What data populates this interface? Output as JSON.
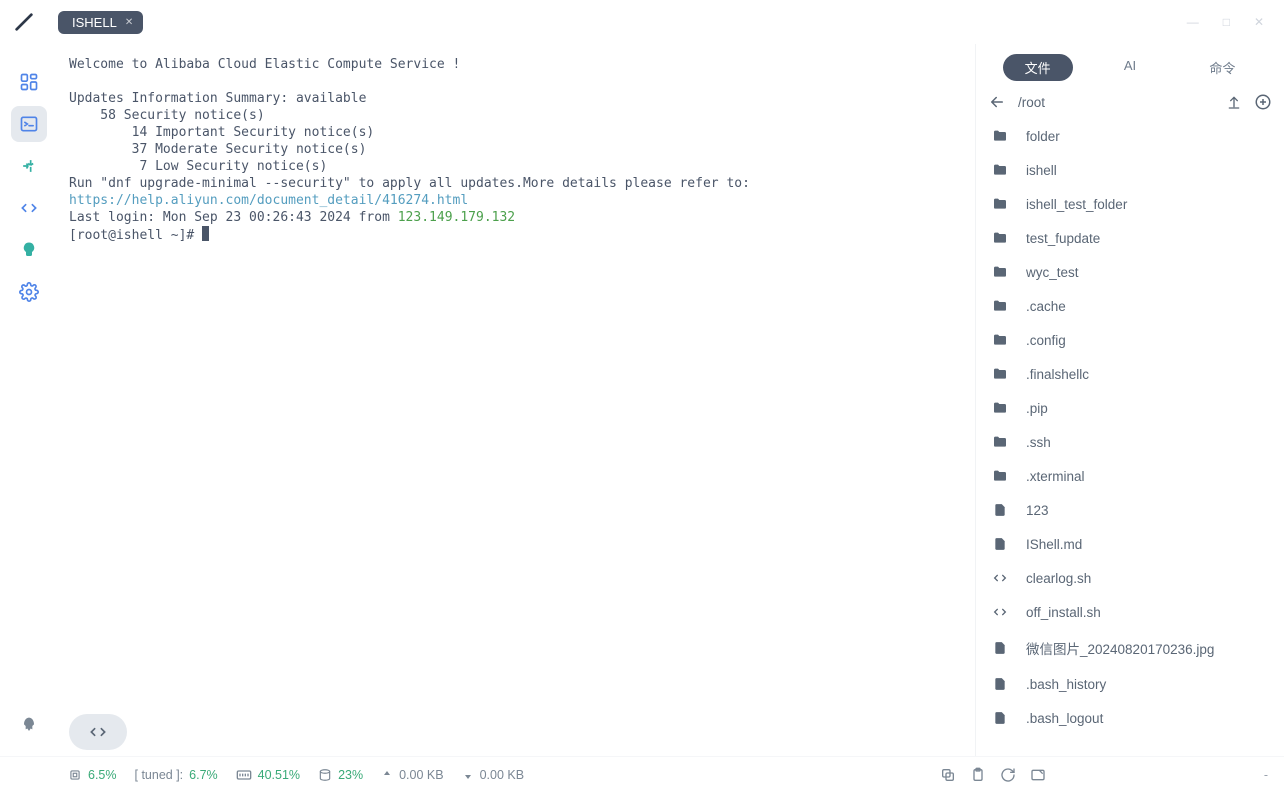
{
  "app": {
    "tab_label": "ISHELL"
  },
  "terminal": {
    "welcome": "Welcome to Alibaba Cloud Elastic Compute Service !",
    "summary_header": "Updates Information Summary: available",
    "sec_total": "    58 Security notice(s)",
    "sec_important": "        14 Important Security notice(s)",
    "sec_moderate": "        37 Moderate Security notice(s)",
    "sec_low": "         7 Low Security notice(s)",
    "run_hint": "Run \"dnf upgrade-minimal --security\" to apply all updates.More details please refer to:",
    "doc_url": "https://help.aliyun.com/document_detail/416274.html",
    "last_login_prefix": "Last login: Mon Sep 23 00:26:43 2024 from ",
    "last_login_ip": "123.149.179.132",
    "prompt": "[root@ishell ~]# "
  },
  "right": {
    "tabs": {
      "files": "文件",
      "ai": "AI",
      "cmd": "命令"
    },
    "path": "/root",
    "items": [
      {
        "icon": "folder",
        "name": "folder"
      },
      {
        "icon": "folder",
        "name": "ishell"
      },
      {
        "icon": "folder",
        "name": "ishell_test_folder"
      },
      {
        "icon": "folder",
        "name": "test_fupdate"
      },
      {
        "icon": "folder",
        "name": "wyc_test"
      },
      {
        "icon": "folder",
        "name": ".cache"
      },
      {
        "icon": "folder",
        "name": ".config"
      },
      {
        "icon": "folder",
        "name": ".finalshellc"
      },
      {
        "icon": "folder",
        "name": ".pip"
      },
      {
        "icon": "folder",
        "name": ".ssh"
      },
      {
        "icon": "folder",
        "name": ".xterminal"
      },
      {
        "icon": "file",
        "name": "123"
      },
      {
        "icon": "file",
        "name": "IShell.md"
      },
      {
        "icon": "code",
        "name": "clearlog.sh"
      },
      {
        "icon": "code",
        "name": "off_install.sh"
      },
      {
        "icon": "file",
        "name": "微信图片_20240820170236.jpg"
      },
      {
        "icon": "file",
        "name": ".bash_history"
      },
      {
        "icon": "file",
        "name": ".bash_logout"
      }
    ]
  },
  "status": {
    "cpu": "6.5%",
    "tuned_label": "[ tuned ]:",
    "tuned": "6.7%",
    "mem": "40.51%",
    "disk": "23%",
    "up": "0.00 KB",
    "down": "0.00 KB",
    "dash": "-"
  }
}
